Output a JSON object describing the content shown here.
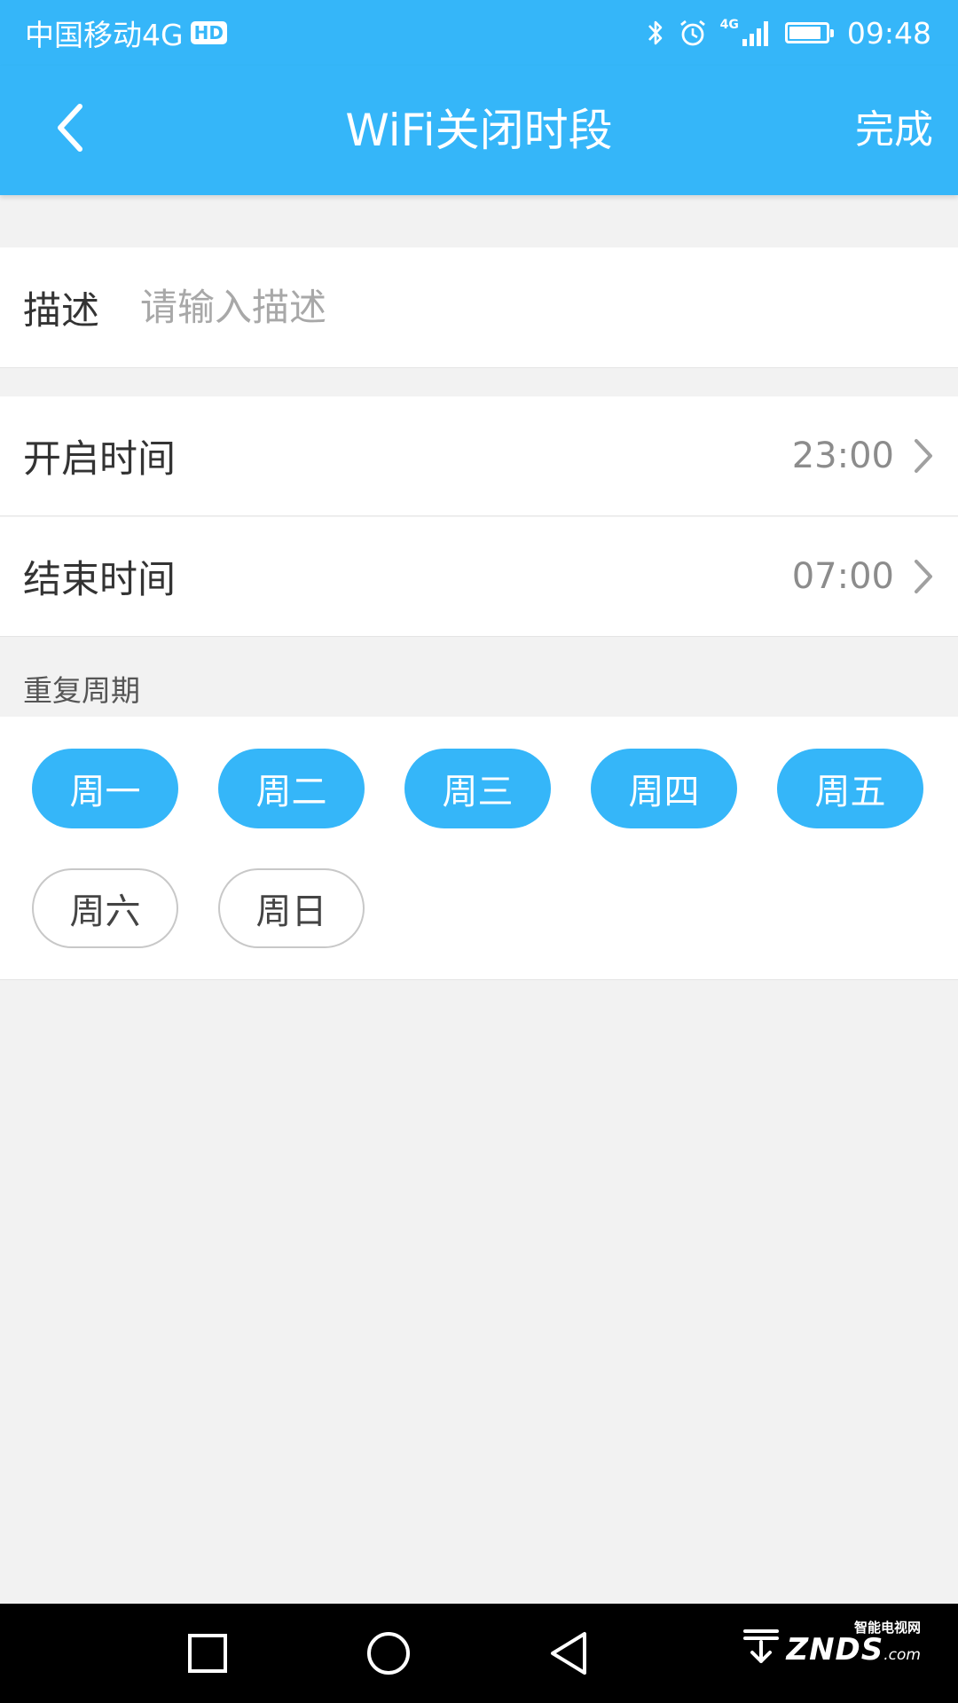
{
  "status_bar": {
    "carrier": "中国移动4G",
    "hd_badge": "HD",
    "network_label": "4G",
    "time": "09:48",
    "battery_level": 0.8,
    "icons": [
      "bluetooth-icon",
      "alarm-icon",
      "signal-icon",
      "battery-icon"
    ]
  },
  "header": {
    "title": "WiFi关闭时段",
    "done_label": "完成",
    "back_icon": "chevron-left-icon"
  },
  "description": {
    "label": "描述",
    "value": "",
    "placeholder": "请输入描述"
  },
  "start_time": {
    "label": "开启时间",
    "value": "23:00"
  },
  "end_time": {
    "label": "结束时间",
    "value": "07:00"
  },
  "repeat": {
    "label": "重复周期",
    "days": [
      {
        "label": "周一",
        "selected": true
      },
      {
        "label": "周二",
        "selected": true
      },
      {
        "label": "周三",
        "selected": true
      },
      {
        "label": "周四",
        "selected": true
      },
      {
        "label": "周五",
        "selected": true
      },
      {
        "label": "周六",
        "selected": false
      },
      {
        "label": "周日",
        "selected": false
      }
    ]
  },
  "nav_bar": {
    "buttons": [
      "recents-icon",
      "home-icon",
      "back-icon"
    ]
  },
  "watermark": {
    "small_text": "智能电视网",
    "main_text": "ZNDS",
    "suffix": ".com"
  },
  "colors": {
    "accent": "#35b6f9",
    "background": "#f2f2f2",
    "nav_bar": "#000000"
  }
}
